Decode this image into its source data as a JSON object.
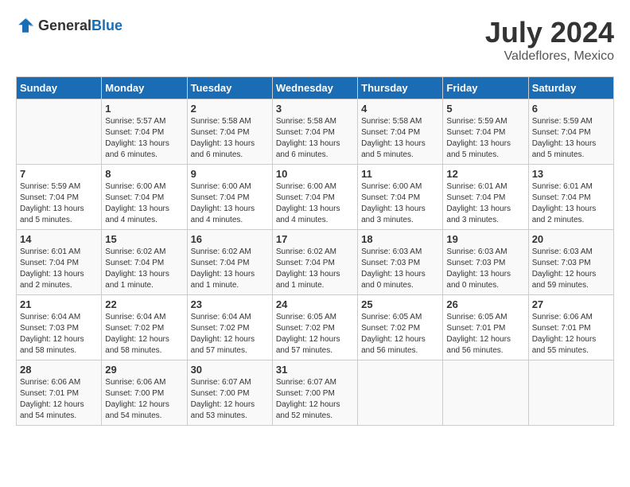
{
  "header": {
    "logo": {
      "general": "General",
      "blue": "Blue"
    },
    "title": "July 2024",
    "location": "Valdeflores, Mexico"
  },
  "columns": [
    "Sunday",
    "Monday",
    "Tuesday",
    "Wednesday",
    "Thursday",
    "Friday",
    "Saturday"
  ],
  "weeks": [
    [
      {
        "day": "",
        "info": ""
      },
      {
        "day": "1",
        "info": "Sunrise: 5:57 AM\nSunset: 7:04 PM\nDaylight: 13 hours\nand 6 minutes."
      },
      {
        "day": "2",
        "info": "Sunrise: 5:58 AM\nSunset: 7:04 PM\nDaylight: 13 hours\nand 6 minutes."
      },
      {
        "day": "3",
        "info": "Sunrise: 5:58 AM\nSunset: 7:04 PM\nDaylight: 13 hours\nand 6 minutes."
      },
      {
        "day": "4",
        "info": "Sunrise: 5:58 AM\nSunset: 7:04 PM\nDaylight: 13 hours\nand 5 minutes."
      },
      {
        "day": "5",
        "info": "Sunrise: 5:59 AM\nSunset: 7:04 PM\nDaylight: 13 hours\nand 5 minutes."
      },
      {
        "day": "6",
        "info": "Sunrise: 5:59 AM\nSunset: 7:04 PM\nDaylight: 13 hours\nand 5 minutes."
      }
    ],
    [
      {
        "day": "7",
        "info": "Sunrise: 5:59 AM\nSunset: 7:04 PM\nDaylight: 13 hours\nand 5 minutes."
      },
      {
        "day": "8",
        "info": "Sunrise: 6:00 AM\nSunset: 7:04 PM\nDaylight: 13 hours\nand 4 minutes."
      },
      {
        "day": "9",
        "info": "Sunrise: 6:00 AM\nSunset: 7:04 PM\nDaylight: 13 hours\nand 4 minutes."
      },
      {
        "day": "10",
        "info": "Sunrise: 6:00 AM\nSunset: 7:04 PM\nDaylight: 13 hours\nand 4 minutes."
      },
      {
        "day": "11",
        "info": "Sunrise: 6:00 AM\nSunset: 7:04 PM\nDaylight: 13 hours\nand 3 minutes."
      },
      {
        "day": "12",
        "info": "Sunrise: 6:01 AM\nSunset: 7:04 PM\nDaylight: 13 hours\nand 3 minutes."
      },
      {
        "day": "13",
        "info": "Sunrise: 6:01 AM\nSunset: 7:04 PM\nDaylight: 13 hours\nand 2 minutes."
      }
    ],
    [
      {
        "day": "14",
        "info": "Sunrise: 6:01 AM\nSunset: 7:04 PM\nDaylight: 13 hours\nand 2 minutes."
      },
      {
        "day": "15",
        "info": "Sunrise: 6:02 AM\nSunset: 7:04 PM\nDaylight: 13 hours\nand 1 minute."
      },
      {
        "day": "16",
        "info": "Sunrise: 6:02 AM\nSunset: 7:04 PM\nDaylight: 13 hours\nand 1 minute."
      },
      {
        "day": "17",
        "info": "Sunrise: 6:02 AM\nSunset: 7:04 PM\nDaylight: 13 hours\nand 1 minute."
      },
      {
        "day": "18",
        "info": "Sunrise: 6:03 AM\nSunset: 7:03 PM\nDaylight: 13 hours\nand 0 minutes."
      },
      {
        "day": "19",
        "info": "Sunrise: 6:03 AM\nSunset: 7:03 PM\nDaylight: 13 hours\nand 0 minutes."
      },
      {
        "day": "20",
        "info": "Sunrise: 6:03 AM\nSunset: 7:03 PM\nDaylight: 12 hours\nand 59 minutes."
      }
    ],
    [
      {
        "day": "21",
        "info": "Sunrise: 6:04 AM\nSunset: 7:03 PM\nDaylight: 12 hours\nand 58 minutes."
      },
      {
        "day": "22",
        "info": "Sunrise: 6:04 AM\nSunset: 7:02 PM\nDaylight: 12 hours\nand 58 minutes."
      },
      {
        "day": "23",
        "info": "Sunrise: 6:04 AM\nSunset: 7:02 PM\nDaylight: 12 hours\nand 57 minutes."
      },
      {
        "day": "24",
        "info": "Sunrise: 6:05 AM\nSunset: 7:02 PM\nDaylight: 12 hours\nand 57 minutes."
      },
      {
        "day": "25",
        "info": "Sunrise: 6:05 AM\nSunset: 7:02 PM\nDaylight: 12 hours\nand 56 minutes."
      },
      {
        "day": "26",
        "info": "Sunrise: 6:05 AM\nSunset: 7:01 PM\nDaylight: 12 hours\nand 56 minutes."
      },
      {
        "day": "27",
        "info": "Sunrise: 6:06 AM\nSunset: 7:01 PM\nDaylight: 12 hours\nand 55 minutes."
      }
    ],
    [
      {
        "day": "28",
        "info": "Sunrise: 6:06 AM\nSunset: 7:01 PM\nDaylight: 12 hours\nand 54 minutes."
      },
      {
        "day": "29",
        "info": "Sunrise: 6:06 AM\nSunset: 7:00 PM\nDaylight: 12 hours\nand 54 minutes."
      },
      {
        "day": "30",
        "info": "Sunrise: 6:07 AM\nSunset: 7:00 PM\nDaylight: 12 hours\nand 53 minutes."
      },
      {
        "day": "31",
        "info": "Sunrise: 6:07 AM\nSunset: 7:00 PM\nDaylight: 12 hours\nand 52 minutes."
      },
      {
        "day": "",
        "info": ""
      },
      {
        "day": "",
        "info": ""
      },
      {
        "day": "",
        "info": ""
      }
    ]
  ]
}
